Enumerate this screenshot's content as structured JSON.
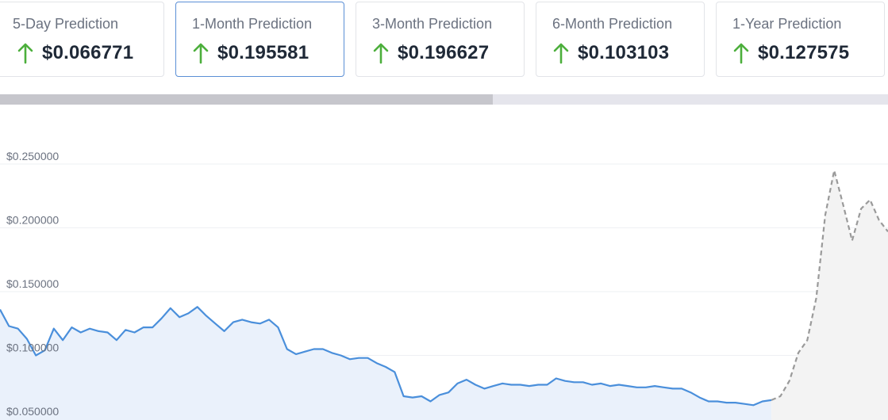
{
  "cards": [
    {
      "label": "5-Day Prediction",
      "value": "0.066771",
      "currency": "$",
      "direction": "up",
      "selected": false
    },
    {
      "label": "1-Month Prediction",
      "value": "0.195581",
      "currency": "$",
      "direction": "up",
      "selected": true
    },
    {
      "label": "3-Month Prediction",
      "value": "0.196627",
      "currency": "$",
      "direction": "up",
      "selected": false
    },
    {
      "label": "6-Month Prediction",
      "value": "0.103103",
      "currency": "$",
      "direction": "up",
      "selected": false
    },
    {
      "label": "1-Year Prediction",
      "value": "0.127575",
      "currency": "$",
      "direction": "up",
      "selected": false
    }
  ],
  "colors": {
    "up_arrow": "#4caf3c",
    "historical_line": "#4a8fdb",
    "historical_fill": "#eaf1fb",
    "forecast_line": "#9a9a9a",
    "forecast_fill": "#f3f3f3",
    "accent_border": "#5b8fd6"
  },
  "scrollbar": {
    "thumb_fraction": 0.555
  },
  "chart_data": {
    "type": "line",
    "title": "",
    "xlabel": "",
    "ylabel": "",
    "ylim": [
      0.05,
      0.27
    ],
    "yticks": [
      0.05,
      0.1,
      0.15,
      0.2,
      0.25
    ],
    "ytick_labels": [
      "$0.050000",
      "$0.100000",
      "$0.150000",
      "$0.200000",
      "$0.250000"
    ],
    "grid": true,
    "series": [
      {
        "style": "solid",
        "x": [
          0,
          1,
          2,
          3,
          4,
          5,
          6,
          7,
          8,
          9,
          10,
          11,
          12,
          13,
          14,
          15,
          16,
          17,
          18,
          19,
          20,
          21,
          22,
          23,
          24,
          25,
          26,
          27,
          28,
          29,
          30,
          31,
          32,
          33,
          34,
          35,
          36,
          37,
          38,
          39,
          40,
          41,
          42,
          43,
          44,
          45,
          46,
          47,
          48,
          49,
          50,
          51,
          52,
          53,
          54,
          55,
          56,
          57,
          58,
          59,
          60,
          61,
          62,
          63,
          64,
          65,
          66,
          67,
          68,
          69,
          70,
          71,
          72,
          73,
          74,
          75,
          76,
          77,
          78,
          79,
          80,
          81,
          82,
          83,
          84,
          85,
          86
        ],
        "y": [
          0.136,
          0.123,
          0.121,
          0.113,
          0.1,
          0.104,
          0.121,
          0.112,
          0.122,
          0.118,
          0.121,
          0.119,
          0.118,
          0.112,
          0.12,
          0.118,
          0.122,
          0.122,
          0.129,
          0.137,
          0.13,
          0.133,
          0.138,
          0.131,
          0.125,
          0.119,
          0.126,
          0.128,
          0.126,
          0.125,
          0.128,
          0.122,
          0.105,
          0.101,
          0.103,
          0.105,
          0.105,
          0.102,
          0.1,
          0.097,
          0.098,
          0.098,
          0.094,
          0.091,
          0.087,
          0.068,
          0.067,
          0.068,
          0.064,
          0.069,
          0.071,
          0.078,
          0.081,
          0.077,
          0.074,
          0.076,
          0.078,
          0.077,
          0.077,
          0.076,
          0.077,
          0.077,
          0.082,
          0.08,
          0.079,
          0.079,
          0.077,
          0.078,
          0.076,
          0.077,
          0.076,
          0.075,
          0.075,
          0.076,
          0.075,
          0.074,
          0.074,
          0.071,
          0.067,
          0.064,
          0.064,
          0.063,
          0.063,
          0.062,
          0.061,
          0.064,
          0.065
        ]
      },
      {
        "style": "dashed",
        "x": [
          86,
          87,
          88,
          89,
          90,
          91,
          92,
          93,
          94,
          95,
          96,
          97,
          98,
          99
        ],
        "y": [
          0.065,
          0.068,
          0.08,
          0.102,
          0.112,
          0.145,
          0.21,
          0.245,
          0.218,
          0.19,
          0.215,
          0.222,
          0.206,
          0.197
        ]
      }
    ]
  }
}
